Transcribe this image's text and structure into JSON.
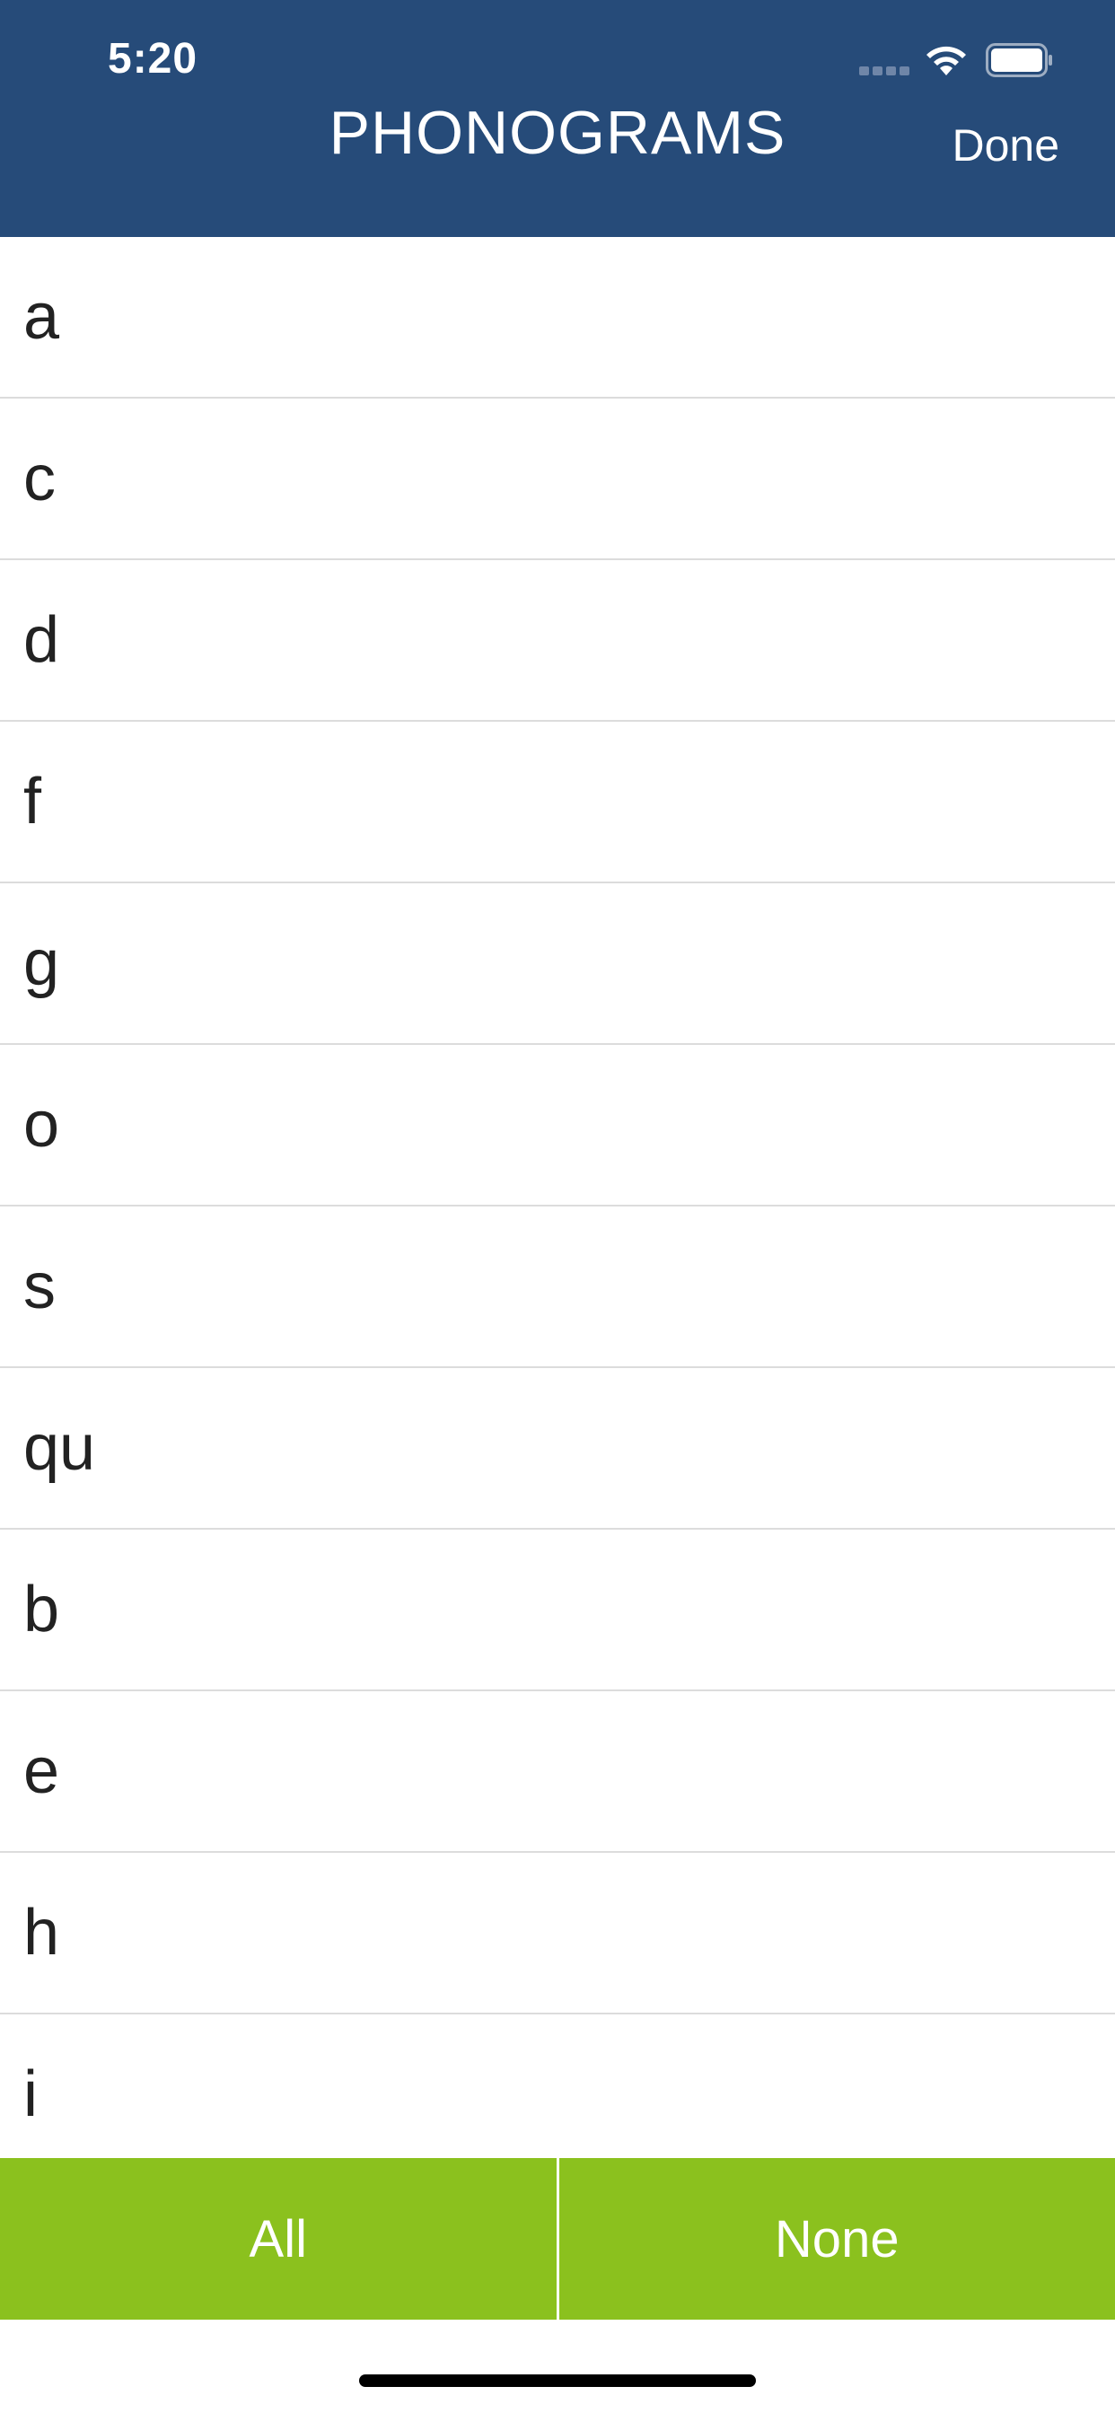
{
  "status_bar": {
    "time": "5:20",
    "icons": [
      "signal-icon",
      "wifi-icon",
      "battery-icon"
    ]
  },
  "nav": {
    "title": "PHONOGRAMS",
    "done_label": "Done"
  },
  "list": {
    "items": [
      {
        "label": "a"
      },
      {
        "label": "c"
      },
      {
        "label": "d"
      },
      {
        "label": "f"
      },
      {
        "label": "g"
      },
      {
        "label": "o"
      },
      {
        "label": "s"
      },
      {
        "label": "qu"
      },
      {
        "label": "b"
      },
      {
        "label": "e"
      },
      {
        "label": "h"
      },
      {
        "label": "i"
      }
    ]
  },
  "footer": {
    "all_label": "All",
    "none_label": "None"
  },
  "colors": {
    "header_bg": "#264b79",
    "footer_bg": "#8bc11e",
    "divider": "#dcdcdc"
  }
}
